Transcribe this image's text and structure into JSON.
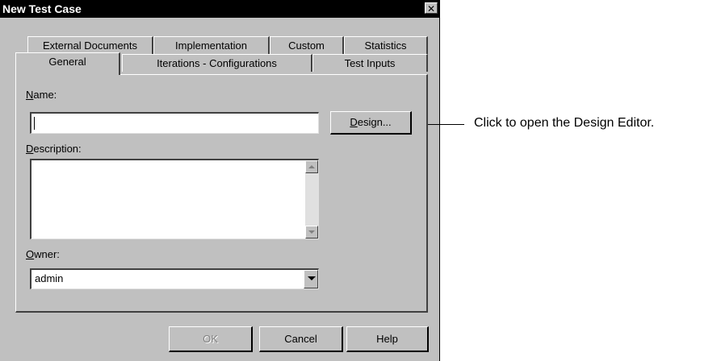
{
  "window": {
    "title": "New Test Case",
    "close_glyph": "✕"
  },
  "tabs": {
    "row_back": [
      {
        "label": "External Documents"
      },
      {
        "label": "Implementation"
      },
      {
        "label": "Custom"
      },
      {
        "label": "Statistics"
      }
    ],
    "row_front": [
      {
        "label": "General",
        "active": true
      },
      {
        "label": "Iterations - Configurations"
      },
      {
        "label": "Test Inputs"
      }
    ]
  },
  "form": {
    "name_label_accel": "N",
    "name_label_rest": "ame:",
    "name_value": "",
    "design_button_accel": "D",
    "design_button_rest": "esign...",
    "description_label_accel": "D",
    "description_label_rest": "escription:",
    "description_value": "",
    "owner_label_accel": "O",
    "owner_label_rest": "wner:",
    "owner_value": "admin"
  },
  "buttons": {
    "ok": "OK",
    "cancel": "Cancel",
    "help": "Help"
  },
  "callout": {
    "text": "Click to open the Design Editor."
  },
  "icons": {
    "close": "close-icon",
    "scroll_up": "arrow-up-icon",
    "scroll_down": "arrow-down-icon",
    "dropdown": "chevron-down-icon"
  }
}
